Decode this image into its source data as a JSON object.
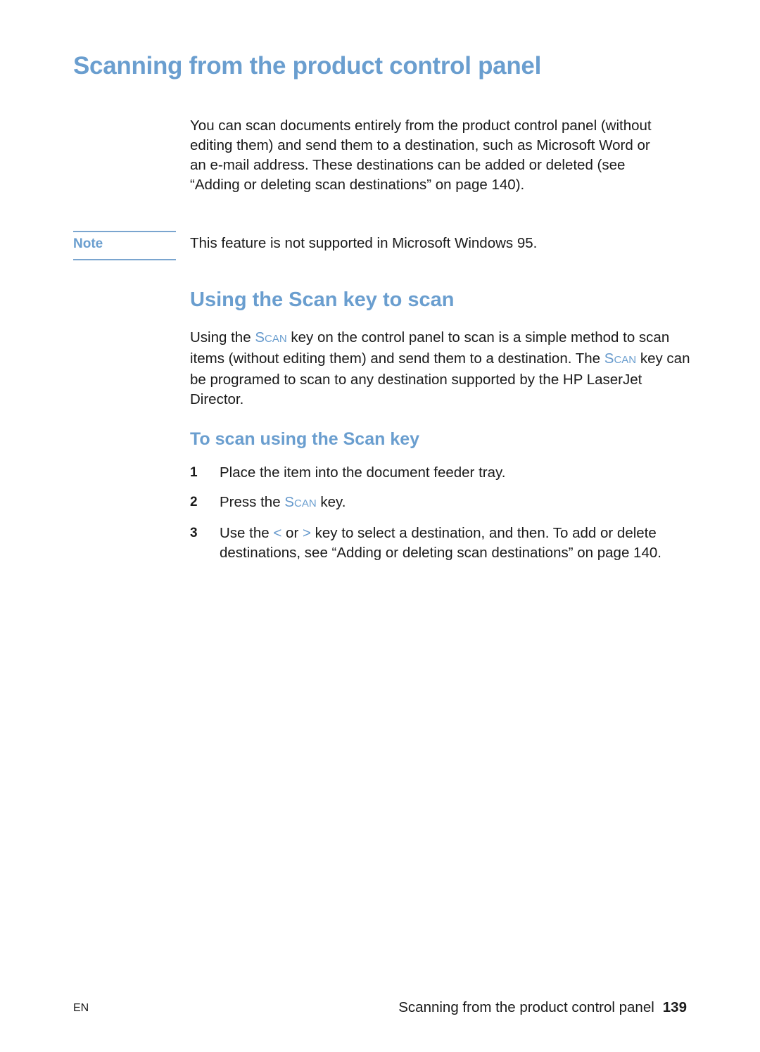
{
  "page": {
    "title": "Scanning from the product control panel",
    "intro": "You can scan documents entirely from the product control panel (without editing them) and send them to a destination, such as Microsoft Word or an e-mail address. These destinations can be added or deleted (see “Adding or deleting scan destinations” on page 140).",
    "note": {
      "label": "Note",
      "text": "This feature is not supported in Microsoft Windows 95."
    },
    "section": {
      "heading": "Using the Scan key to scan",
      "para_part1": "Using the ",
      "key_name": "Scan",
      "para_part2": " key on the control panel to scan is a simple method to scan items (without editing them) and send them to a destination. The ",
      "para_part3": " key can be programed to scan to any destination supported by the HP LaserJet Director."
    },
    "subsection": {
      "heading": "To scan using the Scan key",
      "steps": [
        {
          "num": "1",
          "text": "Place the item into the document feeder tray."
        },
        {
          "num": "2",
          "text_before": "Press the ",
          "key": "Scan",
          "text_after": " key."
        },
        {
          "num": "3",
          "text_before": "Use the ",
          "key_left": "<",
          "text_mid": " or ",
          "key_right": ">",
          "text_after": " key to select a destination, and then. To add or delete destinations, see “Adding or deleting scan destinations” on page 140."
        }
      ]
    },
    "footer": {
      "lang": "EN",
      "chapter": "Scanning from the product control panel",
      "page_number": "139"
    },
    "colors": {
      "accent": "#6a9ecf",
      "text": "#1a1a1a",
      "rule": "#7aa5cf"
    }
  }
}
